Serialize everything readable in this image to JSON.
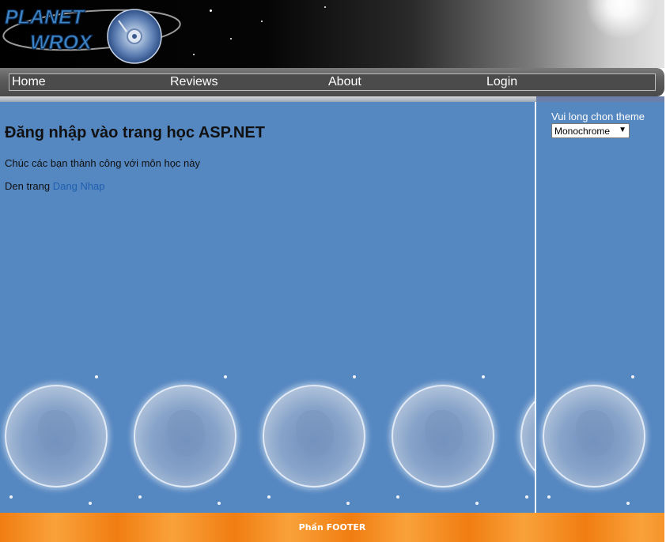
{
  "header": {
    "logo_line1": "PLANET",
    "logo_line2": "WROX"
  },
  "menu": {
    "items": [
      {
        "label": "Home"
      },
      {
        "label": "Reviews"
      },
      {
        "label": "About"
      },
      {
        "label": "Login"
      }
    ]
  },
  "main": {
    "title": "Đăng nhập vào trang học ASP.NET",
    "subtitle": "Chúc các bạn thành công với môn học này",
    "goto_prefix": "Den trang",
    "goto_link": "Dang Nhap"
  },
  "sidebar": {
    "theme_label": "Vui long chon theme",
    "theme_selected": "Monochrome"
  },
  "footer": {
    "text": "Phần FOOTER"
  },
  "colors": {
    "content_bg": "#5587c1",
    "footer_orange": "#f07d12",
    "link_blue": "#1f5fb0"
  }
}
